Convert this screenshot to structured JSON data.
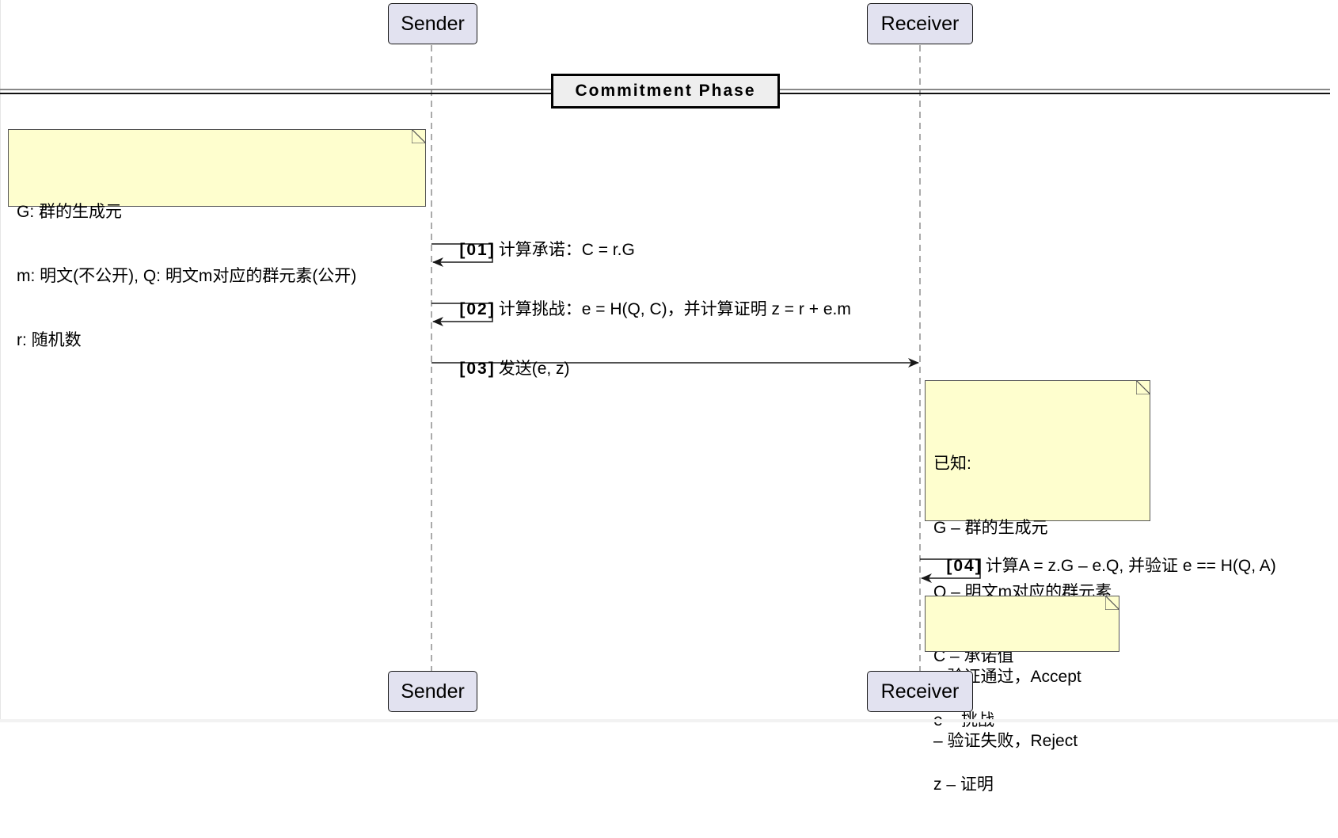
{
  "diagram": {
    "type": "sequence",
    "participants": [
      {
        "id": "sender",
        "label": "Sender"
      },
      {
        "id": "receiver",
        "label": "Receiver"
      }
    ],
    "divider": {
      "label": "Commitment Phase"
    },
    "notes": [
      {
        "id": "note-definitions",
        "anchor": "sender",
        "side": "left",
        "lines": [
          "G: 群的生成元",
          "m: 明文(不公开), Q: 明文m对应的群元素(公开)",
          "r: 随机数"
        ]
      },
      {
        "id": "note-known",
        "anchor": "receiver",
        "side": "right",
        "lines": [
          "已知:",
          "G – 群的生成元",
          "Q – 明文m对应的群元素",
          "C – 承诺值",
          "e – 挑战",
          "z – 证明"
        ]
      },
      {
        "id": "note-result",
        "anchor": "receiver",
        "side": "right",
        "lines": [
          "– 验证通过，Accept",
          "– 验证失败，Reject"
        ]
      }
    ],
    "messages": [
      {
        "number": "[01]",
        "text": "计算承诺：C = r.G",
        "from": "sender",
        "to": "sender"
      },
      {
        "number": "[02]",
        "text": "计算挑战：e = H(Q, C)，并计算证明 z = r + e.m",
        "from": "sender",
        "to": "sender"
      },
      {
        "number": "[03]",
        "text": "发送(e, z)",
        "from": "sender",
        "to": "receiver"
      },
      {
        "number": "[04]",
        "text": "计算A = z.G – e.Q, 并验证 e == H(Q, A)",
        "from": "receiver",
        "to": "receiver"
      }
    ]
  },
  "colors": {
    "participant_fill": "#e2e2f0",
    "note_fill": "#fefece",
    "divider_fill": "#eeeeee",
    "line": "#181818"
  }
}
